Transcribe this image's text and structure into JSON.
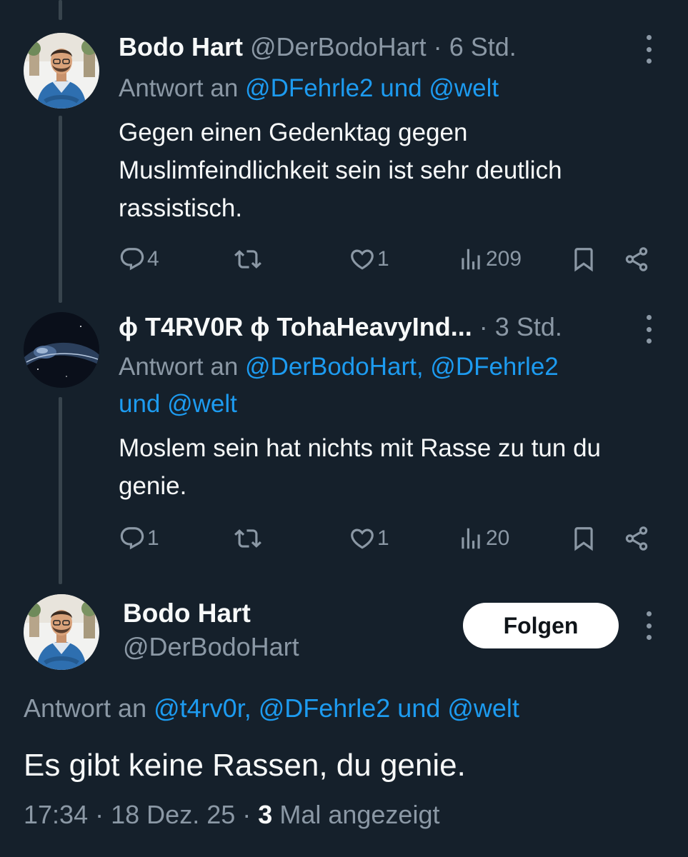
{
  "tweet1": {
    "name": "Bodo Hart",
    "handle": "@DerBodoHart",
    "separator": "·",
    "time": "6 Std.",
    "replying_prefix": "Antwort an",
    "replying_to": "@DFehrle2 und @welt",
    "text": "Gegen einen Gedenktag gegen Muslimfeindlichkeit sein ist sehr deutlich rassistisch.",
    "replies": "4",
    "retweets": "",
    "likes": "1",
    "views": "209"
  },
  "tweet2": {
    "name": "ɸ T4RV0R ɸ TohaHeavyInd...",
    "separator": "·",
    "time": "3 Std.",
    "replying_prefix": "Antwort an",
    "replying_to_line1": "@DerBodoHart, @DFehrle2",
    "replying_to_line2": "und @welt",
    "text": "Moslem sein hat nichts mit Rasse zu tun du genie.",
    "replies": "1",
    "retweets": "",
    "likes": "1",
    "views": "20"
  },
  "main": {
    "name": "Bodo Hart",
    "handle": "@DerBodoHart",
    "follow_label": "Folgen",
    "replying_prefix": "Antwort an",
    "replying_to": "@t4rv0r, @DFehrle2 und @welt",
    "text": "Es gibt keine Rassen, du genie.",
    "time": "17:34",
    "separator": "·",
    "date": "18 Dez. 25",
    "view_count": "3",
    "view_label": "Mal angezeigt"
  },
  "icons": {
    "reply": "reply-icon",
    "retweet": "retweet-icon",
    "like": "heart-icon",
    "views": "views-icon",
    "bookmark": "bookmark-icon",
    "share": "share-icon",
    "more": "more-icon"
  },
  "colors": {
    "background": "#15202b",
    "text": "#f7f9f9",
    "secondary": "#8b98a5",
    "accent": "#1d9bf0",
    "thread_line": "#38444d",
    "button_bg": "#ffffff"
  }
}
